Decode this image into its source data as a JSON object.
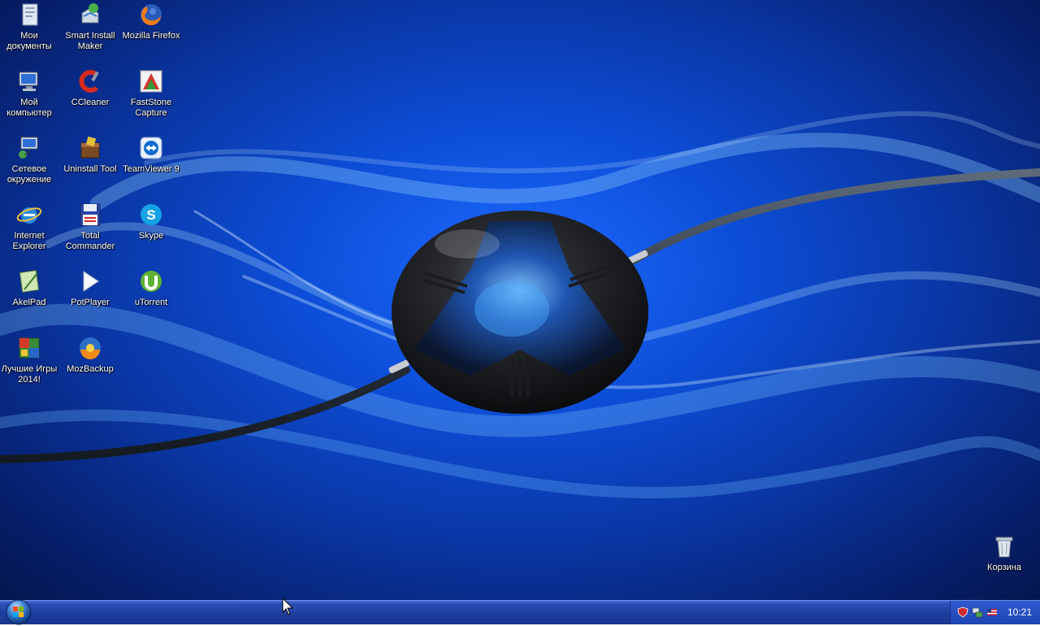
{
  "desktop": {
    "icons": [
      {
        "id": "my-documents",
        "label": "Мои документы",
        "icon": "folder-documents-icon"
      },
      {
        "id": "smart-install-maker",
        "label": "Smart Install Maker",
        "icon": "installer-icon"
      },
      {
        "id": "mozilla-firefox",
        "label": "Mozilla Firefox",
        "icon": "firefox-icon"
      },
      {
        "id": "my-computer",
        "label": "Мой компьютер",
        "icon": "computer-icon"
      },
      {
        "id": "ccleaner",
        "label": "CCleaner",
        "icon": "ccleaner-icon"
      },
      {
        "id": "faststone-capture",
        "label": "FastStone Capture",
        "icon": "faststone-icon"
      },
      {
        "id": "network",
        "label": "Сетевое окружение",
        "icon": "network-icon"
      },
      {
        "id": "uninstall-tool",
        "label": "Uninstall Tool",
        "icon": "uninstall-icon"
      },
      {
        "id": "teamviewer",
        "label": "TeamViewer 9",
        "icon": "teamviewer-icon"
      },
      {
        "id": "internet-explorer",
        "label": "Internet Explorer",
        "icon": "ie-icon"
      },
      {
        "id": "total-commander",
        "label": "Total Commander",
        "icon": "floppy-icon"
      },
      {
        "id": "skype",
        "label": "Skype",
        "icon": "skype-icon"
      },
      {
        "id": "akelpad",
        "label": "AkelPad",
        "icon": "notepad-icon"
      },
      {
        "id": "potplayer",
        "label": "PotPlayer",
        "icon": "play-icon"
      },
      {
        "id": "utorrent",
        "label": "uTorrent",
        "icon": "utorrent-icon"
      },
      {
        "id": "best-games",
        "label": "Лучшие Игры 2014!",
        "icon": "games-icon"
      },
      {
        "id": "mozbackup",
        "label": "MozBackup",
        "icon": "mozbackup-icon"
      }
    ],
    "recycle_bin": {
      "label": "Корзина",
      "icon": "recycle-bin-icon"
    }
  },
  "taskbar": {
    "start_icon": "windows-orb-icon",
    "tray_icons": [
      "shield-icon",
      "network-tray-icon",
      "flag-icon"
    ],
    "clock": "10:21"
  },
  "colors": {
    "taskbar": "#1f3f9e",
    "desktop_bg": "#0d4ed8",
    "label_text": "#ffffff"
  }
}
